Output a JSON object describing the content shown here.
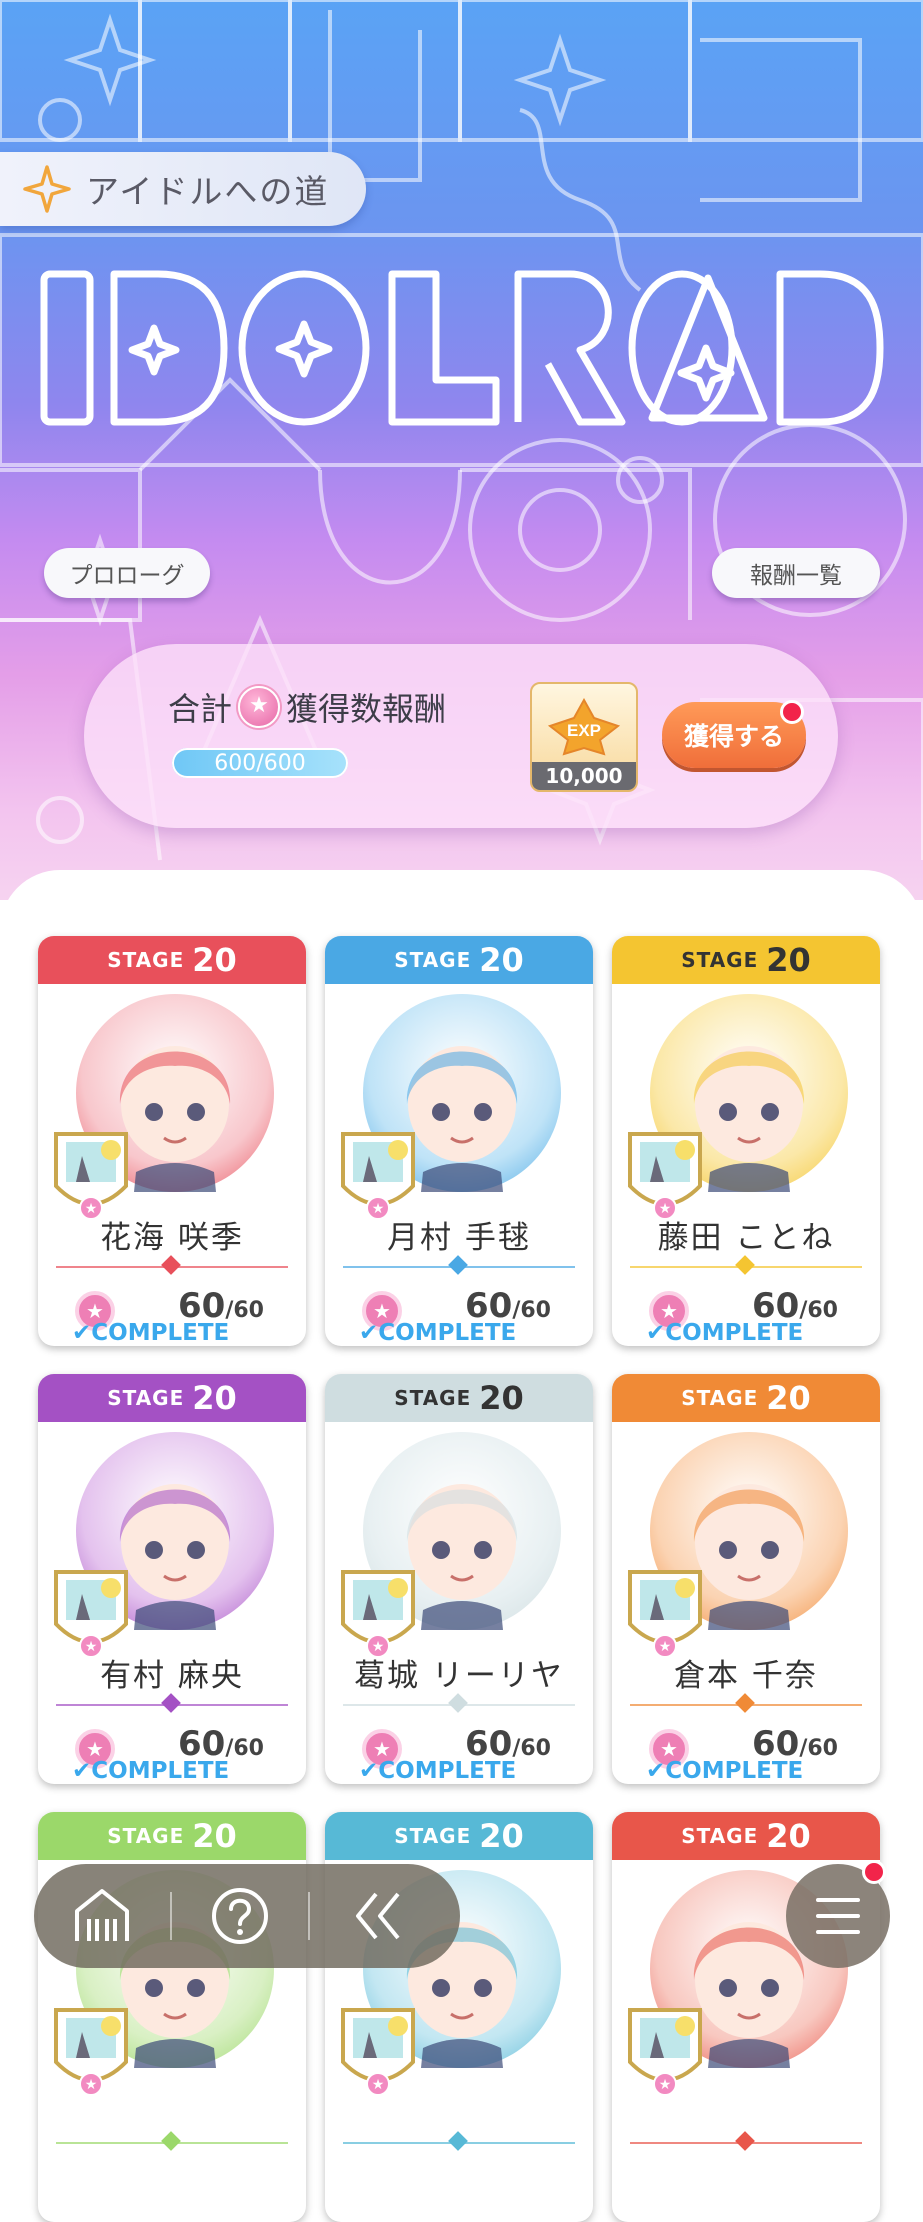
{
  "header": {
    "title": "アイドルへの道",
    "logo_text": "IDOLROAD",
    "prologue_label": "プロローグ",
    "rewards_list_label": "報酬一覧"
  },
  "reward_panel": {
    "title_prefix": "合計",
    "title_suffix": "獲得数報酬",
    "progress_text": "600/600",
    "progress_fraction": 1.0,
    "reward_label": "EXP",
    "reward_amount": "10,000",
    "acquire_label": "獲得する"
  },
  "stage_word": "STAGE",
  "complete_label": "COMPLETE",
  "cards": [
    {
      "stage": "20",
      "name": "花海 咲季",
      "count": "60",
      "max": "/60",
      "color": "#e8505b",
      "bg": "#f8c7cc"
    },
    {
      "stage": "20",
      "name": "月村 手毬",
      "count": "60",
      "max": "/60",
      "color": "#4aa8e4",
      "bg": "#bfe3f7"
    },
    {
      "stage": "20",
      "name": "藤田 ことね",
      "count": "60",
      "max": "/60",
      "color": "#f4c531",
      "bg": "#fbe8a8"
    },
    {
      "stage": "20",
      "name": "有村 麻央",
      "count": "60",
      "max": "/60",
      "color": "#a451c4",
      "bg": "#e4c2ee"
    },
    {
      "stage": "20",
      "name": "葛城 リーリヤ",
      "count": "60",
      "max": "/60",
      "color": "#cfdde0",
      "bg": "#e8f0f2"
    },
    {
      "stage": "20",
      "name": "倉本 千奈",
      "count": "60",
      "max": "/60",
      "color": "#f08a36",
      "bg": "#fbd3b2"
    },
    {
      "stage": "20",
      "name": "",
      "count": "",
      "max": "",
      "color": "#9bd86a",
      "bg": "#d9f0c4"
    },
    {
      "stage": "20",
      "name": "",
      "count": "",
      "max": "",
      "color": "#57b9d6",
      "bg": "#c3e7f2"
    },
    {
      "stage": "20",
      "name": "",
      "count": "",
      "max": "",
      "color": "#e8564a",
      "bg": "#f8c8c0"
    }
  ],
  "nav": {
    "home_icon": "home-icon",
    "help_icon": "help-icon",
    "back_icon": "back-icon",
    "menu_icon": "menu-icon"
  }
}
